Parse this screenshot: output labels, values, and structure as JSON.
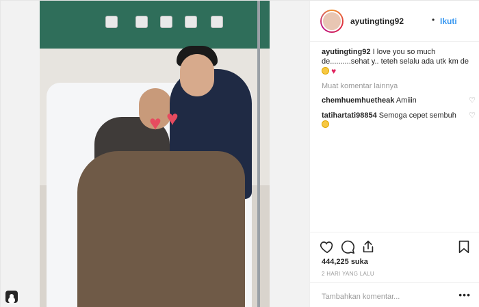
{
  "post": {
    "username": "ayutingting92",
    "separator": "•",
    "follow_label": "Ikuti",
    "caption": {
      "username": "ayutingting92",
      "text": "I love you so much de..........sehat y.. teteh selalu ada utk km de"
    },
    "load_more_comments": "Muat komentar lainnya",
    "comments": [
      {
        "username": "chemhuemhuetheak",
        "text": "Amiiin"
      },
      {
        "username": "tatihartati98854",
        "text": "Semoga cepet sembuh"
      }
    ],
    "likes": "444,225 suka",
    "timestamp": "2 HARI YANG LALU",
    "add_comment_placeholder": "Tambahkan komentar...",
    "more_options": "•••"
  },
  "icons": {
    "like": "heart-outline-icon",
    "comment": "comment-bubble-icon",
    "share": "share-icon",
    "save": "bookmark-icon",
    "user_tag": "user-tag-icon"
  },
  "colors": {
    "accent": "#3897f0",
    "text": "#262626",
    "muted": "#999999",
    "border": "#efefef"
  }
}
